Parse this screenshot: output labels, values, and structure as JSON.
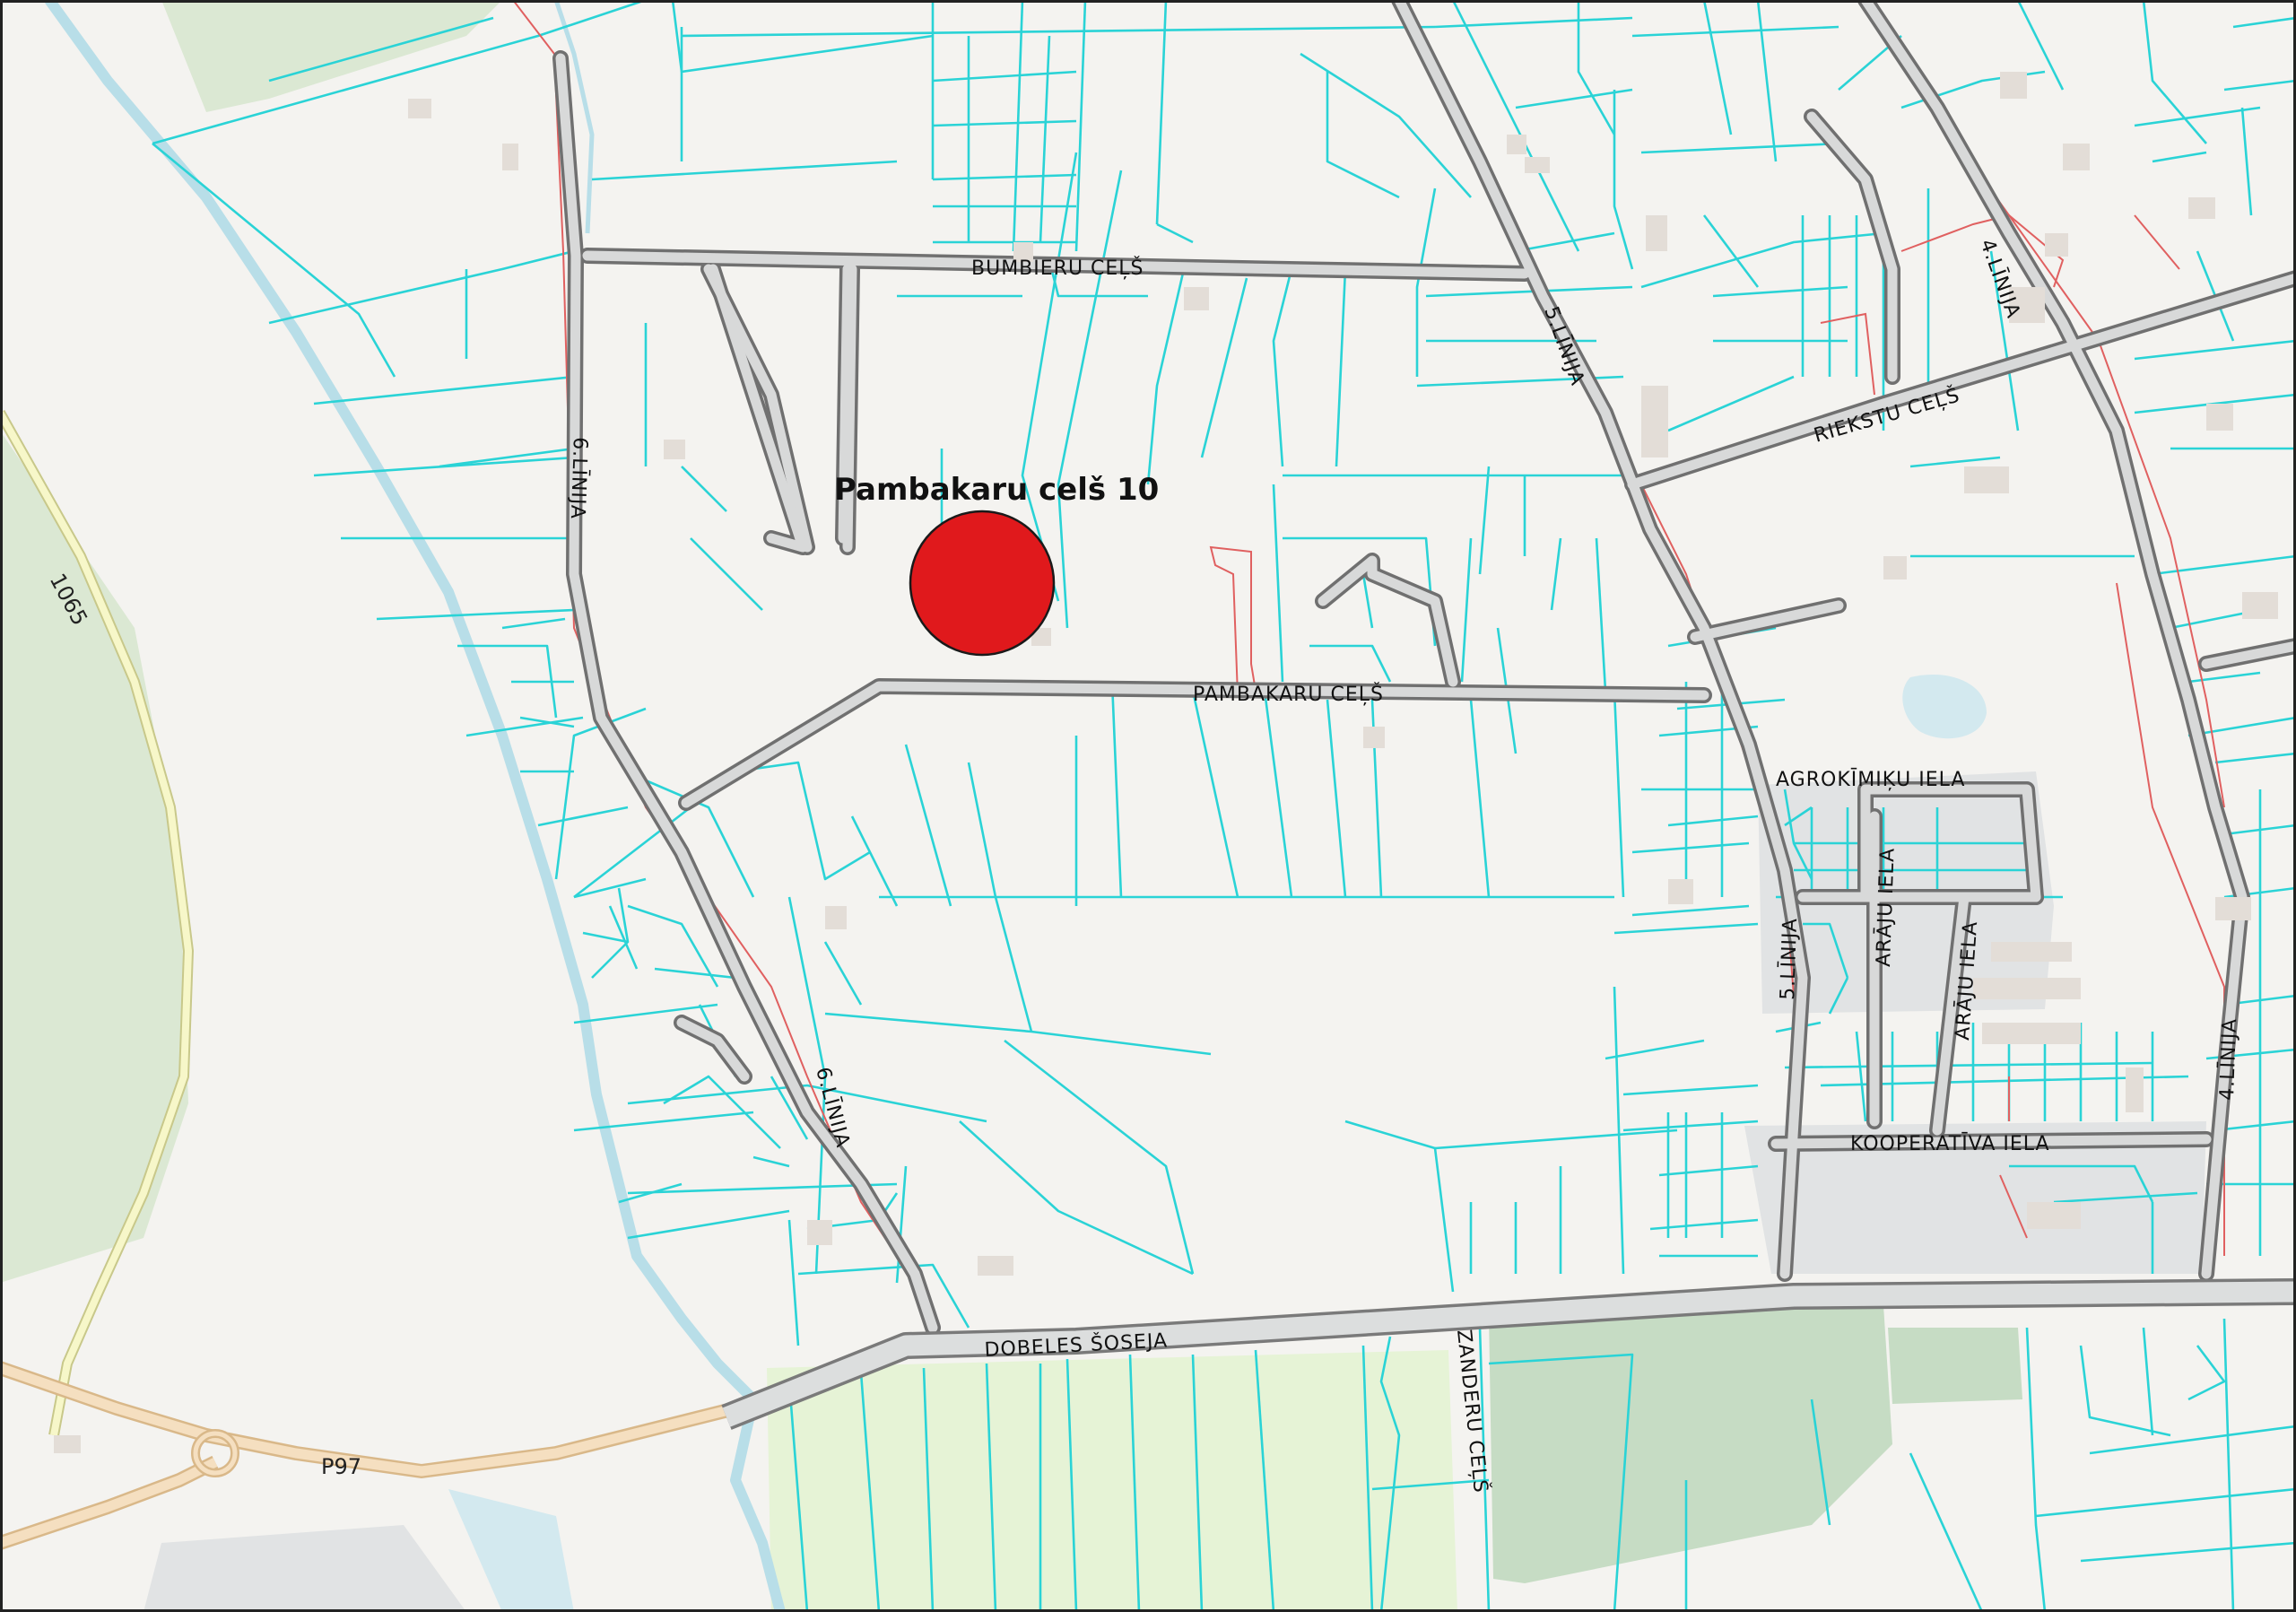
{
  "marker": {
    "title": "Pambakaru celš 10",
    "color": "#e0191c"
  },
  "streets": {
    "bumbieru": "BUMBIERU   CEĻŠ",
    "pambakaru": "PAMBAKARU   CEĻŠ",
    "riekstu": "RIEKSTU   CEĻŠ",
    "agrokimiku": "AGROKĪMIĶU   IELA",
    "kooperativa": "KOOPERATĪVA   IELA",
    "dobeles": "DOBELES   ŠOSEJA",
    "zanderu": "ZANDERU   CEĻŠ",
    "linija6_north": "6.LĪNIJA",
    "linija6_south": "6.LĪNIJA",
    "linija5_north": "5.LĪNIJA",
    "linija5_south": "5.LĪNIJA",
    "linija4_north": "4.LĪNIJA",
    "linija4_south": "4.LĪNIJA",
    "araju_1": "ARĀJU   IELA",
    "araju_2": "ARĀJU   IELA"
  },
  "road_numbers": {
    "v1065": "1065",
    "p97": "P97"
  },
  "colors": {
    "parcel_outline": "#2ad3d6",
    "marker_fill": "#e0191c",
    "background": "#f4f3f0"
  }
}
